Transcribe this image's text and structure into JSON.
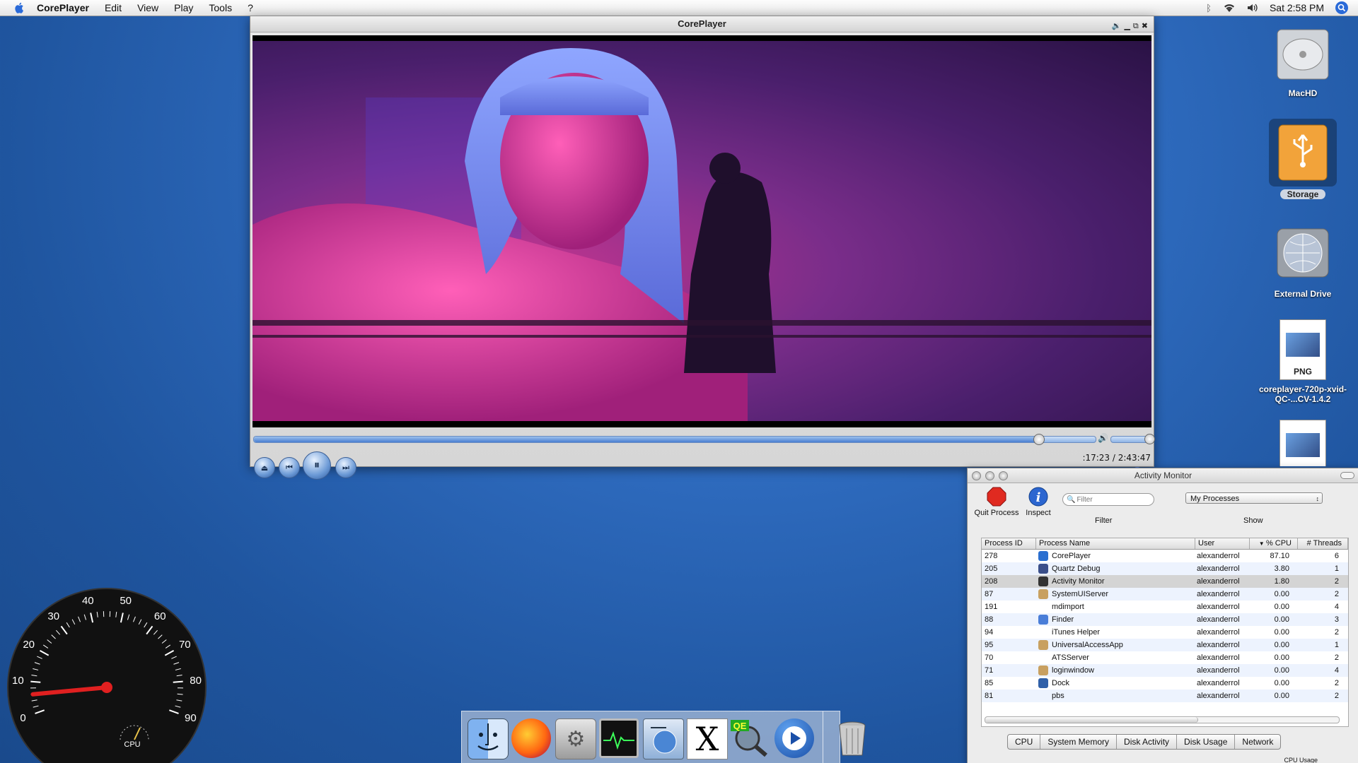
{
  "menubar": {
    "app_name": "CorePlayer",
    "items": [
      "Edit",
      "View",
      "Play",
      "Tools",
      "?"
    ],
    "clock": "Sat 2:58 PM"
  },
  "player": {
    "title": "CorePlayer",
    "time_display": ":17:23 / 2:43:47",
    "seek_position": 0.932,
    "volume_level": 1.0
  },
  "desktop": {
    "icons": [
      {
        "label": "MacHD",
        "icon": "hard-drive-icon"
      },
      {
        "label": "Storage",
        "icon": "usb-drive-icon"
      },
      {
        "label": "External Drive",
        "icon": "network-drive-icon"
      },
      {
        "label": "coreplayer-720p-xvid-QC-...CV-1.4.2",
        "icon": "png-file-icon",
        "badge": "PNG"
      }
    ]
  },
  "activity_monitor": {
    "title": "Activity Monitor",
    "toolbar": {
      "quit_label": "Quit Process",
      "inspect_label": "Inspect",
      "filter_placeholder": "Filter",
      "filter_label": "Filter",
      "show_value": "My Processes",
      "show_label": "Show"
    },
    "columns": [
      "Process ID",
      "Process Name",
      "User",
      "% CPU",
      "# Threads"
    ],
    "rows": [
      {
        "pid": "278",
        "name": "CorePlayer",
        "user": "alexanderrol",
        "cpu": "87.10",
        "threads": "6",
        "icon": "coreplayer-icon",
        "color": "#2a6fd0"
      },
      {
        "pid": "205",
        "name": "Quartz Debug",
        "user": "alexanderrol",
        "cpu": "3.80",
        "threads": "1",
        "icon": "quartz-debug-icon",
        "color": "#3a4f8a"
      },
      {
        "pid": "208",
        "name": "Activity Monitor",
        "user": "alexanderrol",
        "cpu": "1.80",
        "threads": "2",
        "icon": "activity-monitor-icon",
        "color": "#333333"
      },
      {
        "pid": "87",
        "name": "SystemUIServer",
        "user": "alexanderrol",
        "cpu": "0.00",
        "threads": "2",
        "icon": "generic-app-icon",
        "color": "#c8a060"
      },
      {
        "pid": "191",
        "name": "mdimport",
        "user": "alexanderrol",
        "cpu": "0.00",
        "threads": "4",
        "icon": "",
        "color": ""
      },
      {
        "pid": "88",
        "name": "Finder",
        "user": "alexanderrol",
        "cpu": "0.00",
        "threads": "3",
        "icon": "finder-icon",
        "color": "#4a7ed8"
      },
      {
        "pid": "94",
        "name": "iTunes Helper",
        "user": "alexanderrol",
        "cpu": "0.00",
        "threads": "2",
        "icon": "",
        "color": ""
      },
      {
        "pid": "95",
        "name": "UniversalAccessApp",
        "user": "alexanderrol",
        "cpu": "0.00",
        "threads": "1",
        "icon": "generic-app-icon",
        "color": "#c8a060"
      },
      {
        "pid": "70",
        "name": "ATSServer",
        "user": "alexanderrol",
        "cpu": "0.00",
        "threads": "2",
        "icon": "",
        "color": ""
      },
      {
        "pid": "71",
        "name": "loginwindow",
        "user": "alexanderrol",
        "cpu": "0.00",
        "threads": "4",
        "icon": "generic-app-icon",
        "color": "#c8a060"
      },
      {
        "pid": "85",
        "name": "Dock",
        "user": "alexanderrol",
        "cpu": "0.00",
        "threads": "2",
        "icon": "dock-icon",
        "color": "#3060a8"
      },
      {
        "pid": "81",
        "name": "pbs",
        "user": "alexanderrol",
        "cpu": "0.00",
        "threads": "2",
        "icon": "",
        "color": ""
      }
    ],
    "selected_row": 2,
    "tabs": [
      "CPU",
      "System Memory",
      "Disk Activity",
      "Disk Usage",
      "Network"
    ],
    "footer": "CPU Usage"
  },
  "gauge": {
    "ticks": [
      "0",
      "10",
      "20",
      "30",
      "40",
      "50",
      "60",
      "70",
      "80",
      "90"
    ],
    "label": "CPU",
    "needle_value": 6
  },
  "dock": {
    "items": [
      "finder-icon",
      "firefox-icon",
      "system-preferences-icon",
      "activity-monitor-icon",
      "safari-icon",
      "x11-icon",
      "quartz-debug-icon",
      "coreplayer-icon",
      "trash-icon"
    ]
  },
  "colors": {
    "accent": "#3b6fc4",
    "menubar": "#eeeeee"
  }
}
